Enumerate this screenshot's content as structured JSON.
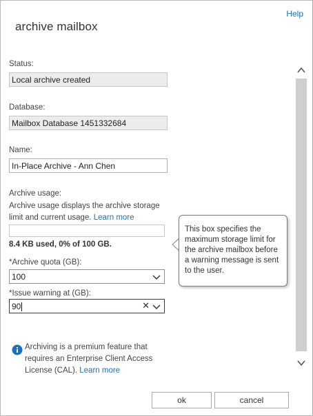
{
  "header": {
    "title": "archive mailbox",
    "help": "Help"
  },
  "form": {
    "status": {
      "label": "Status:",
      "value": "Local archive created"
    },
    "database": {
      "label": "Database:",
      "value": "Mailbox Database 1451332684"
    },
    "name": {
      "label": "Name:",
      "value": "In-Place Archive - Ann Chen"
    },
    "usage": {
      "label": "Archive usage:",
      "description": "Archive usage displays the archive storage limit and current usage.",
      "learn_more": "Learn more",
      "fraction": 0.0,
      "used_text": "8.4 KB used, 0% of 100 GB."
    },
    "quota": {
      "label": "*Archive quota (GB):",
      "value": "100"
    },
    "warning": {
      "label": "*Issue warning at (GB):",
      "value": "90",
      "clear": "✕"
    }
  },
  "tooltip": {
    "text": "This box specifies the maximum storage limit for the archive mailbox before a warning message is sent to the user."
  },
  "info": {
    "text": "Archiving is a premium feature that requires an Enterprise Client Access License (CAL).",
    "learn_more": "Learn more"
  },
  "buttons": {
    "ok": "ok",
    "cancel": "cancel"
  },
  "colors": {
    "link": "#1e6fb8",
    "info_icon": "#1e6fb8",
    "scroll_track": "#cfcfcf"
  }
}
